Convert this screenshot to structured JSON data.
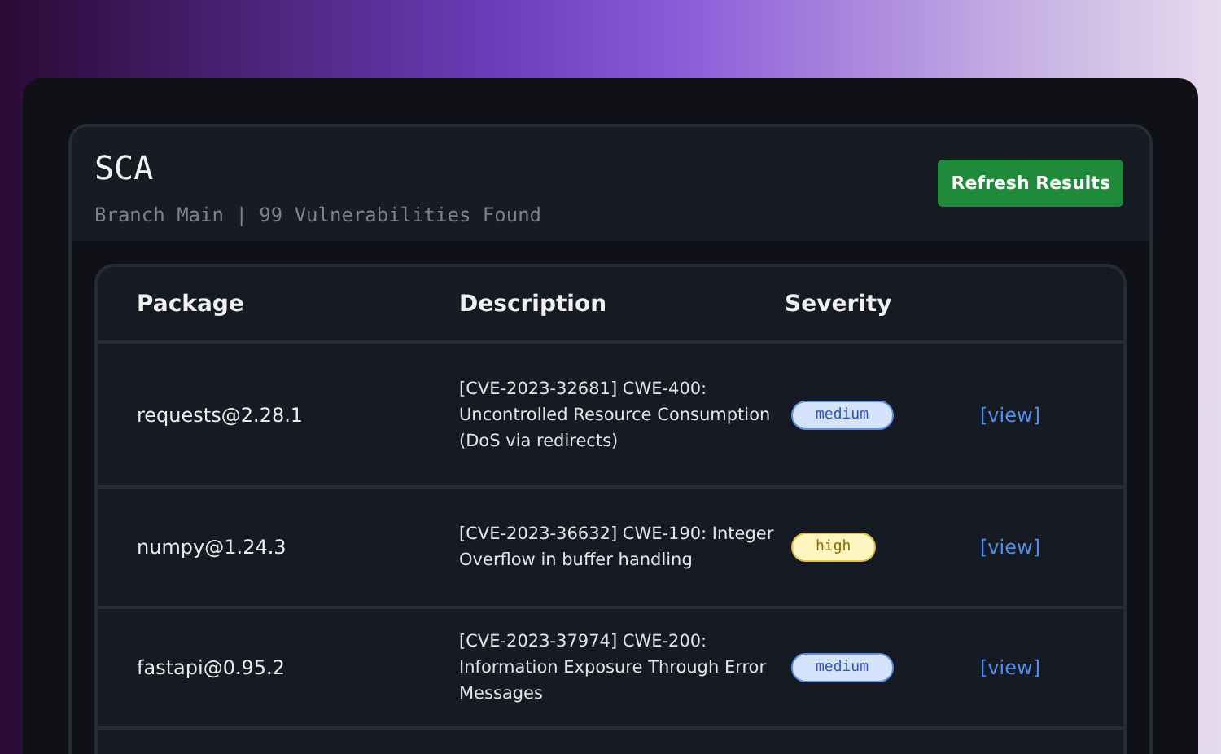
{
  "header": {
    "title": "SCA",
    "subtitle": "Branch Main | 99 Vulnerabilities Found",
    "button": "Refresh Results"
  },
  "table": {
    "columns": [
      "Package",
      "Description",
      "Severity"
    ],
    "rows": [
      {
        "package": "requests@2.28.1",
        "description": "[CVE-2023-32681] CWE-400: Uncontrolled Resource Consumption (DoS via redirects)",
        "severity": "medium",
        "link": "[view]"
      },
      {
        "package": "numpy@1.24.3",
        "description": "[CVE-2023-36632] CWE-190: Integer Overflow in buffer handling",
        "severity": "high",
        "link": "[view]"
      },
      {
        "package": "fastapi@0.95.2",
        "description": "[CVE-2023-37974] CWE-200: Information Exposure Through Error Messages",
        "severity": "medium",
        "link": "[view]"
      }
    ]
  }
}
